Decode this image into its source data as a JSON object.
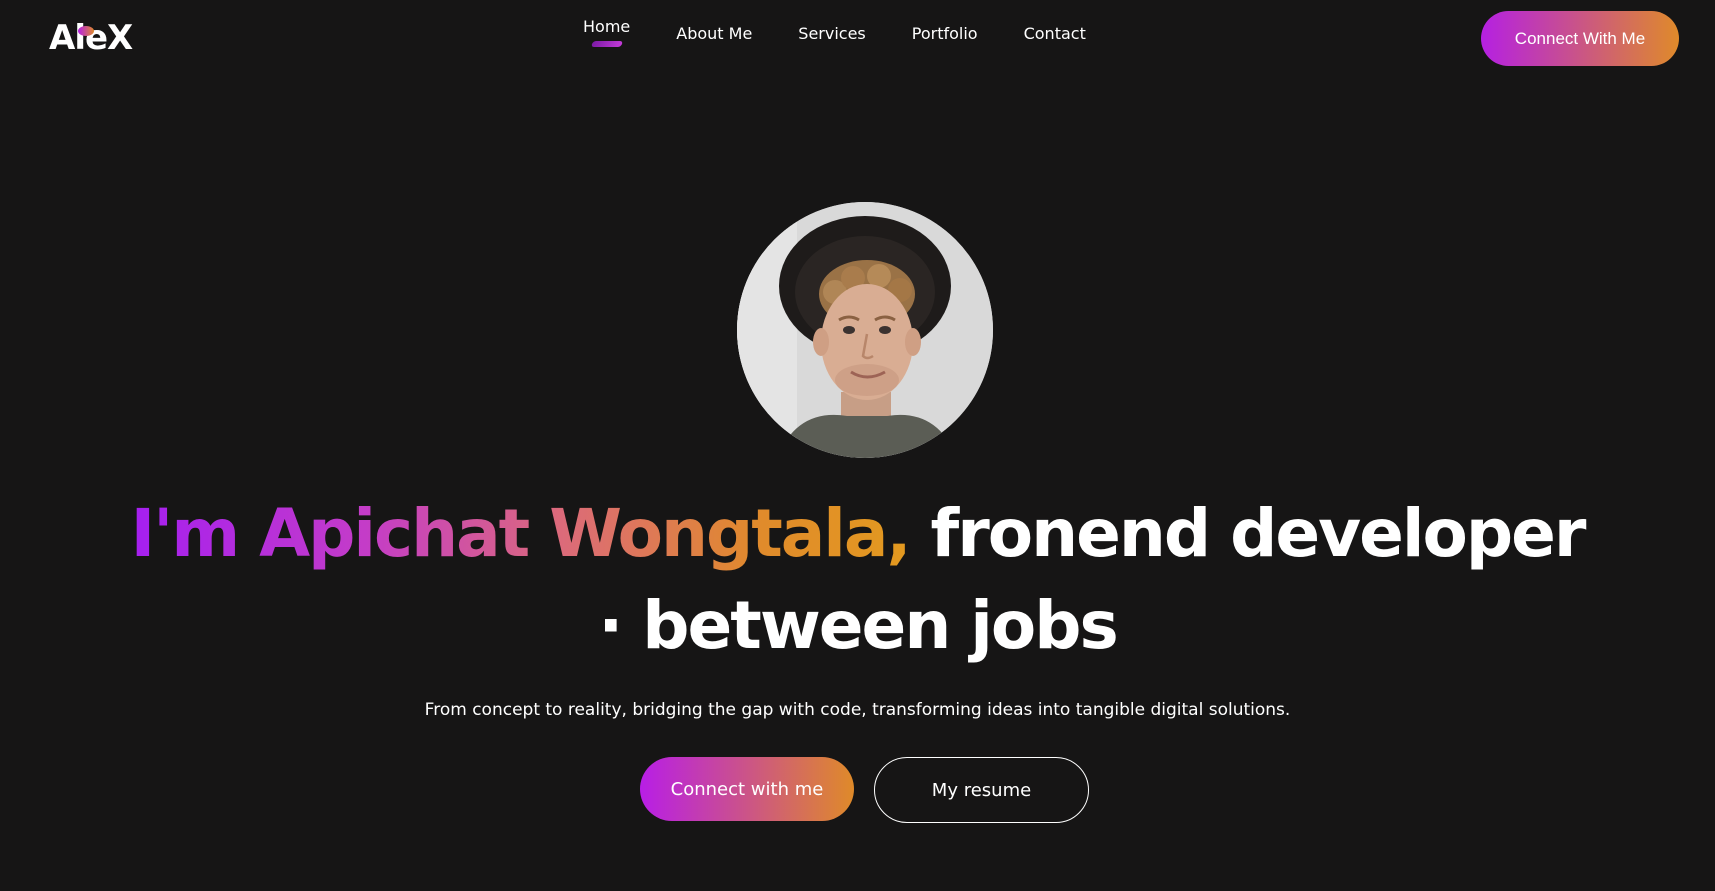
{
  "brand": {
    "logo": "AleX"
  },
  "nav": {
    "items": [
      {
        "label": "Home",
        "active": true
      },
      {
        "label": "About Me",
        "active": false
      },
      {
        "label": "Services",
        "active": false
      },
      {
        "label": "Portfolio",
        "active": false
      },
      {
        "label": "Contact",
        "active": false
      }
    ],
    "cta_label": "Connect With Me"
  },
  "hero": {
    "avatar_icon": "profile-photo",
    "title_highlight": "I'm Apichat Wongtala,",
    "title_rest": "fronend developer",
    "title_line2": "· between jobs",
    "subtitle": "From concept to reality, bridging the gap with code, transforming ideas into tangible digital solutions.",
    "primary_button": "Connect with me",
    "secondary_button": "My resume"
  },
  "colors": {
    "background": "#161515",
    "gradient_start": "#b61fe6",
    "gradient_end": "#df8a2c",
    "text": "#ffffff"
  }
}
